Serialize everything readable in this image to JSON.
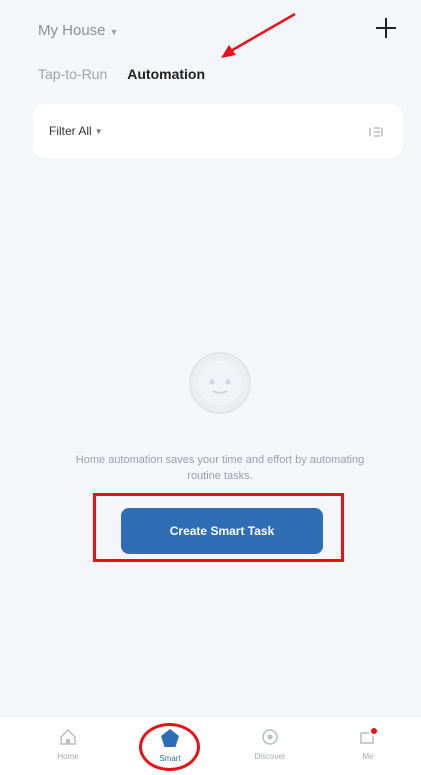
{
  "header": {
    "home_label": "My House",
    "add_icon": "plus-icon"
  },
  "tabs": [
    {
      "label": "Tap-to-Run",
      "active": false
    },
    {
      "label": "Automation",
      "active": true
    }
  ],
  "filter": {
    "label": "Filter All",
    "menu_icon": "menu-icon"
  },
  "empty_state": {
    "icon": "empty-face-icon",
    "message": "Home automation saves your time and effort by automating routine tasks.",
    "button_label": "Create Smart Task"
  },
  "tabbar": {
    "items": [
      {
        "label": "Home",
        "icon": "home-icon"
      },
      {
        "label": "Smart",
        "icon": "smart-icon",
        "active": true
      },
      {
        "label": "Discover",
        "icon": "discover-icon"
      },
      {
        "label": "Me",
        "icon": "me-icon"
      }
    ]
  },
  "colors": {
    "accent": "#2f6eb5",
    "annotation": "#e5121a",
    "background": "#f5f6f9"
  }
}
